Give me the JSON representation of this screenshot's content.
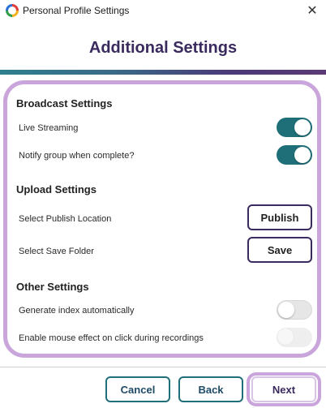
{
  "window": {
    "title": "Personal Profile Settings",
    "close_glyph": "✕"
  },
  "heading": "Additional Settings",
  "accent_colors": {
    "teal": "#1f6f78",
    "purple": "#3a2a5e",
    "highlight": "#c9a5dc"
  },
  "broadcast": {
    "title": "Broadcast Settings",
    "live_streaming": {
      "label": "Live Streaming",
      "state": "on"
    },
    "notify_group": {
      "label": "Notify group when complete?",
      "state": "on"
    }
  },
  "upload": {
    "title": "Upload Settings",
    "publish_location": {
      "label": "Select Publish Location",
      "button": "Publish"
    },
    "save_folder": {
      "label": "Select Save Folder",
      "button": "Save"
    }
  },
  "other": {
    "title": "Other Settings",
    "generate_index": {
      "label": "Generate index automatically",
      "state": "off"
    },
    "mouse_effect": {
      "label": "Enable mouse effect on click during recordings",
      "state": "disabled"
    }
  },
  "footer": {
    "cancel": "Cancel",
    "back": "Back",
    "next": "Next"
  }
}
